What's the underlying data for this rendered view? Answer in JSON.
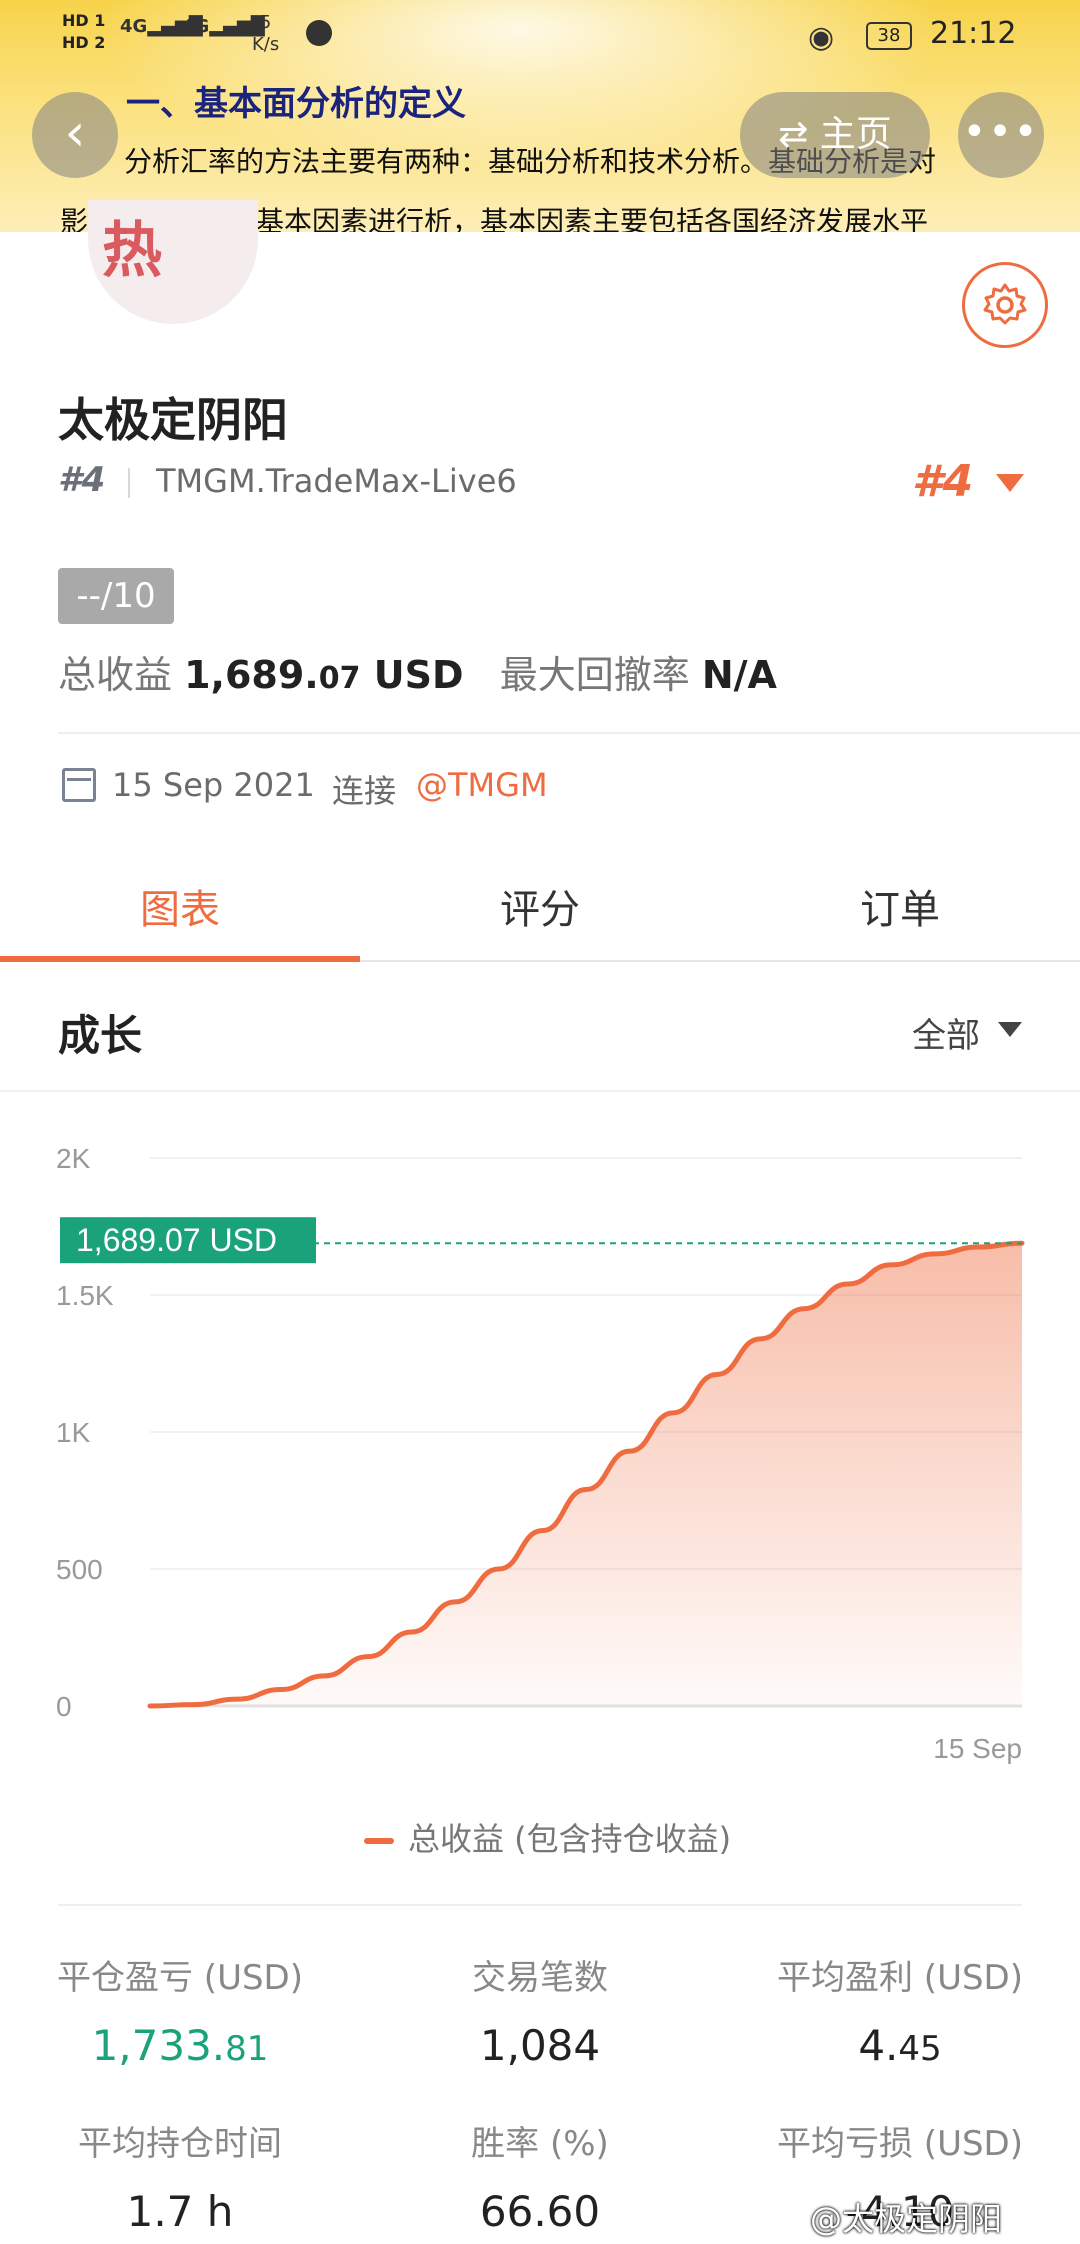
{
  "status_bar": {
    "sim1": "HD 1",
    "sim2": "HD 2",
    "net1": "4G",
    "net2": "4G",
    "speed_value": "5",
    "speed_unit": "K/s",
    "battery": "38",
    "time": "21:12"
  },
  "article_behind": {
    "heading": "一、基本面分析的定义",
    "line1": "分析汇率的方法主要有两种：基础分析和技术分析。基础分析是对",
    "line2": "影响外汇汇率的基本因素进行析，基本因素主要包括各国经济发展水平"
  },
  "nav": {
    "back_icon": "chevron-left-icon",
    "home_label": "⇄ 主页",
    "more_icon": "more-dots-icon"
  },
  "profile": {
    "name": "太极定阴阳",
    "rank_small": "#4",
    "server": "TMGM.TradeMax-Live6",
    "rank_big": "#4",
    "score": "--/10",
    "total_profit_label": "总收益",
    "total_profit_int": "1,689.",
    "total_profit_dec": "07",
    "total_profit_unit": "USD",
    "max_drawdown_label": "最大回撤率",
    "max_drawdown_value": "N/A",
    "connect_date": "15 Sep 2021",
    "connect_label": "连接",
    "broker": "@TMGM"
  },
  "tabs": [
    {
      "label": "图表",
      "active": true
    },
    {
      "label": "评分",
      "active": false
    },
    {
      "label": "订单",
      "active": false
    }
  ],
  "growth": {
    "title": "成长",
    "range": "全部",
    "current_label": "1,689.07 USD",
    "legend": "总收益 (包含持仓收益)"
  },
  "chart_data": {
    "type": "area",
    "title": "成长",
    "y_ticks": [
      "0",
      "500",
      "1K",
      "1.5K",
      "2K"
    ],
    "x_labels": [
      "15 Sep"
    ],
    "ylim": [
      0,
      2000
    ],
    "series": [
      {
        "name": "总收益 (包含持仓收益)",
        "values": [
          0,
          5,
          25,
          60,
          110,
          180,
          270,
          380,
          500,
          640,
          790,
          930,
          1070,
          1210,
          1340,
          1450,
          1540,
          1610,
          1650,
          1675,
          1689.07
        ]
      }
    ],
    "current_value_label": "1,689.07 USD",
    "colors": {
      "line": "#ee6c3f",
      "reference": "#1aa37a"
    },
    "grid": true
  },
  "stats": [
    {
      "label": "平仓盈亏 (USD)",
      "value_int": "1,733.",
      "value_dec": "81",
      "highlight": true
    },
    {
      "label": "交易笔数",
      "value_int": "1,084",
      "value_dec": "",
      "highlight": false
    },
    {
      "label": "平均盈利 (USD)",
      "value_int": "4.",
      "value_dec": "45",
      "highlight": false
    },
    {
      "label": "平均持仓时间",
      "value_int": "1.7 h",
      "value_dec": "",
      "highlight": false
    },
    {
      "label": "胜率 (%)",
      "value_int": "66.60",
      "value_dec": "",
      "highlight": false
    },
    {
      "label": "平均亏损 (USD)",
      "value_int": "-4.10",
      "value_dec": "",
      "highlight": false
    }
  ],
  "watermark": "@太极定阴阳",
  "colors": {
    "accent": "#ee6c3f",
    "green": "#1aa37a",
    "text": "#222222",
    "muted": "#777777"
  }
}
